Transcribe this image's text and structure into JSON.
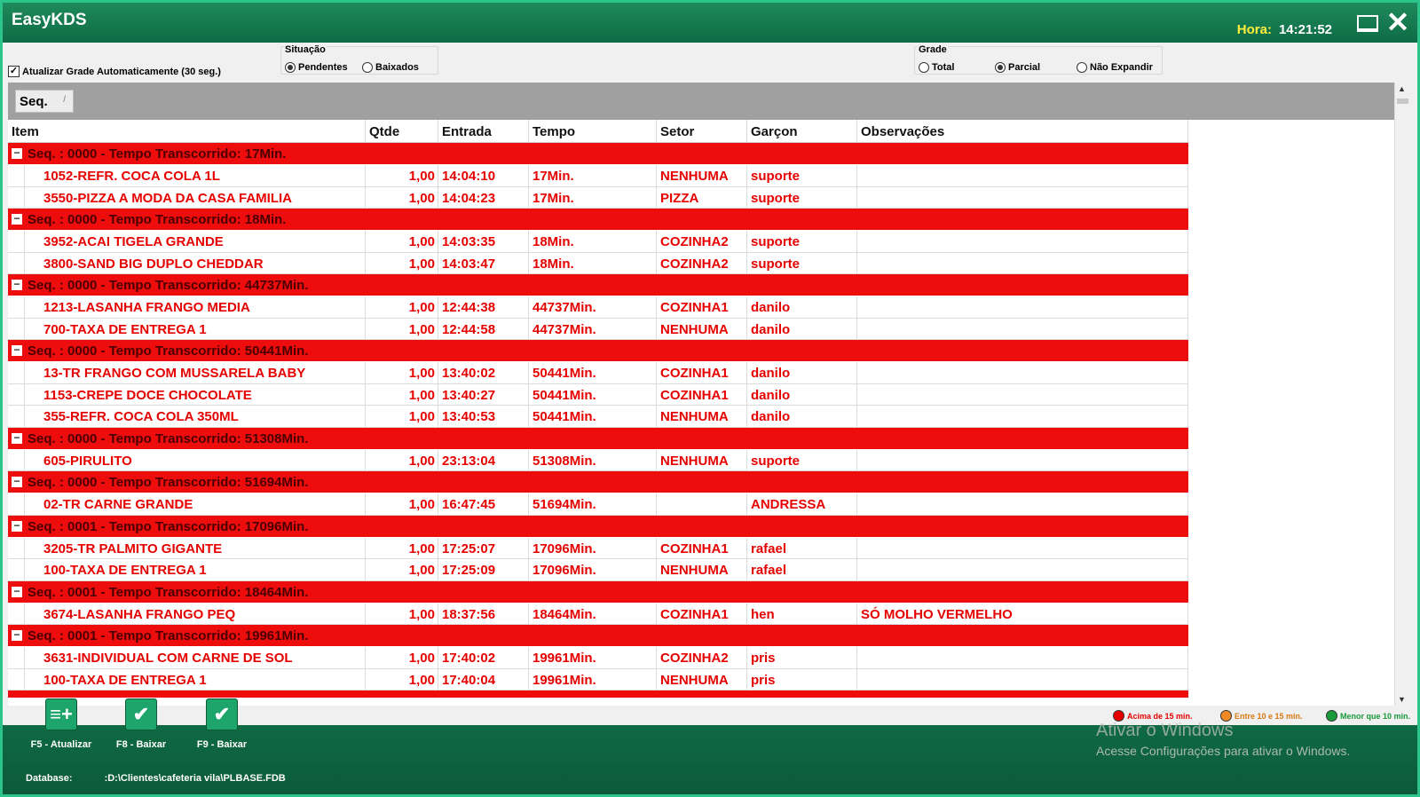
{
  "window": {
    "title": "EasyKDS",
    "clock_label": "Hora:",
    "clock_value": "14:21:52"
  },
  "toolbar": {
    "auto_refresh_label": "Atualizar Grade Automaticamente (30 seg.)",
    "auto_refresh_checked": true,
    "situacao": {
      "legend": "Situação",
      "options": [
        "Pendentes",
        "Baixados"
      ],
      "selected": "Pendentes"
    },
    "grade": {
      "legend": "Grade",
      "options": [
        "Total",
        "Parcial",
        "Não Expandir"
      ],
      "selected": "Parcial"
    }
  },
  "group_panel": {
    "chip_label": "Seq."
  },
  "grid": {
    "columns": [
      "Item",
      "Qtde",
      "Entrada",
      "Tempo",
      "Setor",
      "Garçon",
      "Observações"
    ],
    "groups": [
      {
        "header": "Seq. : 0000 - Tempo Transcorrido: 17Min.",
        "rows": [
          [
            "1052-REFR. COCA COLA 1L",
            "1,00",
            "14:04:10",
            "17Min.",
            "NENHUMA",
            "suporte",
            ""
          ],
          [
            "3550-PIZZA A MODA DA CASA FAMILIA",
            "1,00",
            "14:04:23",
            "17Min.",
            "PIZZA",
            "suporte",
            ""
          ]
        ]
      },
      {
        "header": "Seq. : 0000 - Tempo Transcorrido: 18Min.",
        "rows": [
          [
            "3952-ACAI TIGELA GRANDE",
            "1,00",
            "14:03:35",
            "18Min.",
            "COZINHA2",
            "suporte",
            ""
          ],
          [
            "3800-SAND BIG DUPLO CHEDDAR",
            "1,00",
            "14:03:47",
            "18Min.",
            "COZINHA2",
            "suporte",
            ""
          ]
        ]
      },
      {
        "header": "Seq. : 0000 - Tempo Transcorrido: 44737Min.",
        "rows": [
          [
            "1213-LASANHA FRANGO MEDIA",
            "1,00",
            "12:44:38",
            "44737Min.",
            "COZINHA1",
            "danilo",
            ""
          ],
          [
            "700-TAXA DE ENTREGA 1",
            "1,00",
            "12:44:58",
            "44737Min.",
            "NENHUMA",
            "danilo",
            ""
          ]
        ]
      },
      {
        "header": "Seq. : 0000 - Tempo Transcorrido: 50441Min.",
        "rows": [
          [
            "13-TR FRANGO COM MUSSARELA BABY",
            "1,00",
            "13:40:02",
            "50441Min.",
            "COZINHA1",
            "danilo",
            ""
          ],
          [
            "1153-CREPE DOCE CHOCOLATE",
            "1,00",
            "13:40:27",
            "50441Min.",
            "COZINHA1",
            "danilo",
            ""
          ],
          [
            "355-REFR. COCA COLA 350ML",
            "1,00",
            "13:40:53",
            "50441Min.",
            "NENHUMA",
            "danilo",
            ""
          ]
        ]
      },
      {
        "header": "Seq. : 0000 - Tempo Transcorrido: 51308Min.",
        "rows": [
          [
            "605-PIRULITO",
            "1,00",
            "23:13:04",
            "51308Min.",
            "NENHUMA",
            "suporte",
            ""
          ]
        ]
      },
      {
        "header": "Seq. : 0000 - Tempo Transcorrido: 51694Min.",
        "rows": [
          [
            "02-TR CARNE GRANDE",
            "1,00",
            "16:47:45",
            "51694Min.",
            "",
            "ANDRESSA",
            ""
          ]
        ]
      },
      {
        "header": "Seq. : 0001 - Tempo Transcorrido: 17096Min.",
        "rows": [
          [
            "3205-TR PALMITO GIGANTE",
            "1,00",
            "17:25:07",
            "17096Min.",
            "COZINHA1",
            "rafael",
            ""
          ],
          [
            "100-TAXA DE ENTREGA 1",
            "1,00",
            "17:25:09",
            "17096Min.",
            "NENHUMA",
            "rafael",
            ""
          ]
        ]
      },
      {
        "header": "Seq. : 0001 - Tempo Transcorrido: 18464Min.",
        "rows": [
          [
            "3674-LASANHA FRANGO PEQ",
            "1,00",
            "18:37:56",
            "18464Min.",
            "COZINHA1",
            "hen",
            "SÓ MOLHO VERMELHO"
          ]
        ]
      },
      {
        "header": "Seq. : 0001 - Tempo Transcorrido: 19961Min.",
        "rows": [
          [
            "3631-INDIVIDUAL COM CARNE DE SOL",
            "1,00",
            "17:40:02",
            "19961Min.",
            "COZINHA2",
            "pris",
            ""
          ],
          [
            "100-TAXA DE ENTREGA 1",
            "1,00",
            "17:40:04",
            "19961Min.",
            "NENHUMA",
            "pris",
            ""
          ]
        ]
      }
    ]
  },
  "footer": {
    "buttons": [
      {
        "label": "F5 - Atualizar",
        "icon": "add-list-icon",
        "glyph": "≡+"
      },
      {
        "label": "F8 - Baixar",
        "icon": "check-icon",
        "glyph": "✔"
      },
      {
        "label": "F9 - Baixar",
        "icon": "check-icon",
        "glyph": "✔"
      }
    ],
    "database_label": "Database:",
    "database_value": ":D:\\Clientes\\cafeteria vila\\PLBASE.FDB",
    "legend": [
      {
        "label": "Acima de 15 min.",
        "color": "#e60000"
      },
      {
        "label": "Entre 10 e 15 min.",
        "color": "#f08a24"
      },
      {
        "label": "Menor que 10 min.",
        "color": "#1a9a3a"
      }
    ]
  },
  "watermark": {
    "line1": "Ativar o Windows",
    "line2": "Acesse Configurações para ativar o Windows."
  },
  "colors": {
    "brand": "#0e6b44",
    "accent_border": "#2bc48a",
    "row_red": "#ee0d0d",
    "text_red": "#e60000"
  }
}
